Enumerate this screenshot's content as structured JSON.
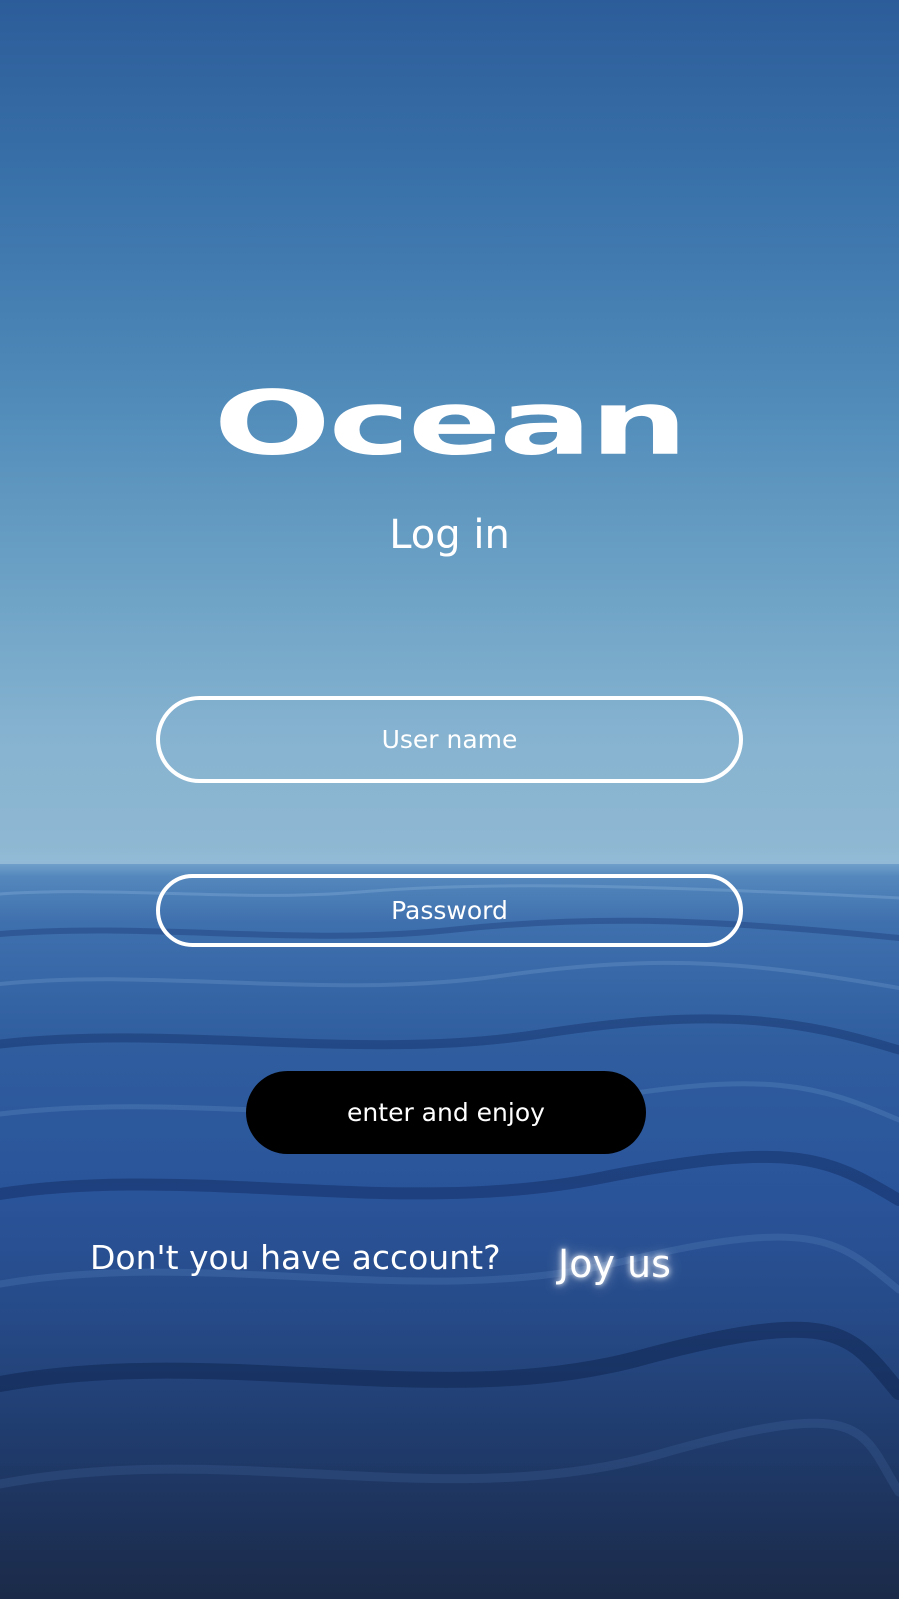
{
  "app": {
    "logo_text": "Ocean",
    "subtitle": "Log in"
  },
  "form": {
    "username_placeholder": "User name",
    "password_placeholder": "Password",
    "submit_label": "enter and enjoy"
  },
  "signup": {
    "prompt": "Don't you have account?",
    "link_label": "Joy us"
  },
  "colors": {
    "text": "#ffffff",
    "button_bg": "#000000",
    "sky_top": "#2c5d9a",
    "sky_horizon": "#8fb8d2",
    "sea_mid": "#2a549a",
    "sea_bottom": "#1b2a48"
  }
}
